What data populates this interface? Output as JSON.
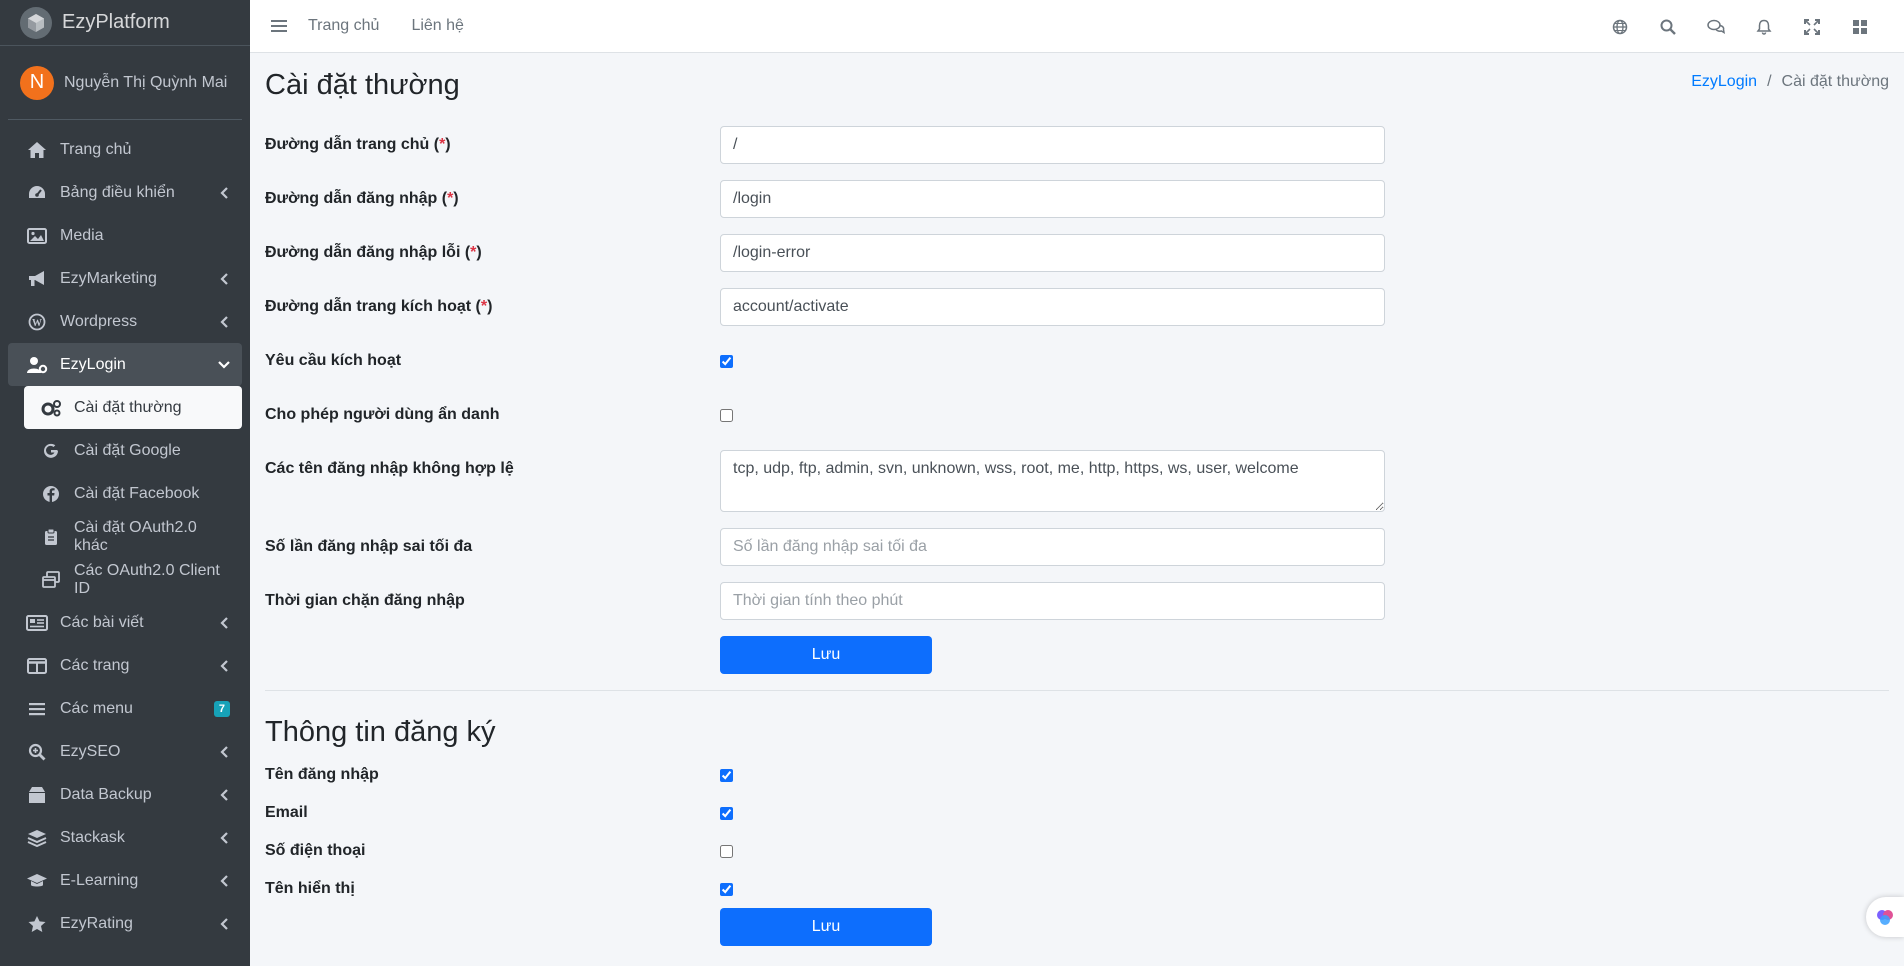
{
  "brand": {
    "name": "EzyPlatform"
  },
  "user": {
    "initial": "N",
    "name": "Nguyễn Thị Quỳnh Mai"
  },
  "sidebar": {
    "items": [
      {
        "label": "Trang chủ",
        "icon": "home-icon"
      },
      {
        "label": "Bảng điều khiển",
        "icon": "dashboard-icon"
      },
      {
        "label": "Media",
        "icon": "image-icon"
      },
      {
        "label": "EzyMarketing",
        "icon": "megaphone-icon"
      },
      {
        "label": "Wordpress",
        "icon": "wordpress-icon"
      },
      {
        "label": "EzyLogin",
        "icon": "user-cog-icon"
      },
      {
        "label": "Các bài viết",
        "icon": "newspaper-icon"
      },
      {
        "label": "Các trang",
        "icon": "columns-icon"
      },
      {
        "label": "Các menu",
        "icon": "bars-icon",
        "badge": "7"
      },
      {
        "label": "EzySEO",
        "icon": "search-plus-icon"
      },
      {
        "label": "Data Backup",
        "icon": "box-icon"
      },
      {
        "label": "Stackask",
        "icon": "layers-icon"
      },
      {
        "label": "E-Learning",
        "icon": "graduation-cap-icon"
      },
      {
        "label": "EzyRating",
        "icon": "star-icon"
      }
    ],
    "sub": [
      {
        "label": "Cài đặt thường",
        "icon": "gears-icon"
      },
      {
        "label": "Cài đặt Google",
        "icon": "google-icon"
      },
      {
        "label": "Cài đặt Facebook",
        "icon": "facebook-icon"
      },
      {
        "label": "Cài đặt OAuth2.0 khác",
        "icon": "clipboard-icon"
      },
      {
        "label": "Các OAuth2.0 Client ID",
        "icon": "window-restore-icon"
      }
    ]
  },
  "topbar": {
    "home": "Trang chủ",
    "contact": "Liên hệ"
  },
  "page": {
    "title": "Cài đặt thường",
    "breadcrumb": {
      "parent": "EzyLogin",
      "current": "Cài đặt thường"
    }
  },
  "form": {
    "home_path": {
      "label": "Đường dẫn trang chủ (",
      "req": "*",
      "end": ")",
      "value": "/"
    },
    "login_path": {
      "label": "Đường dẫn đăng nhập (",
      "req": "*",
      "end": ")",
      "value": "/login"
    },
    "login_error_path": {
      "label": "Đường dẫn đăng nhập lỗi (",
      "req": "*",
      "end": ")",
      "value": "/login-error"
    },
    "activate_path": {
      "label": "Đường dẫn trang kích hoạt (",
      "req": "*",
      "end": ")",
      "value": "account/activate"
    },
    "require_activation": {
      "label": "Yêu cầu kích hoạt",
      "checked": true
    },
    "allow_anonymous": {
      "label": "Cho phép người dùng ẩn danh",
      "checked": false
    },
    "invalid_usernames": {
      "label": "Các tên đăng nhập không hợp lệ",
      "value": "tcp, udp, ftp, admin, svn, unknown, wss, root, me, http, https, ws, user, welcome"
    },
    "max_failed": {
      "label": "Số lần đăng nhập sai tối đa",
      "placeholder": "Số lần đăng nhập sai tối đa"
    },
    "block_time": {
      "label": "Thời gian chặn đăng nhập",
      "placeholder": "Thời gian tính theo phút"
    },
    "save": "Lưu"
  },
  "register": {
    "title": "Thông tin đăng ký",
    "username": {
      "label": "Tên đăng nhập",
      "checked": true
    },
    "email": {
      "label": "Email",
      "checked": true
    },
    "phone": {
      "label": "Số điện thoại",
      "checked": false
    },
    "display_name": {
      "label": "Tên hiển thị",
      "checked": true
    },
    "save": "Lưu"
  }
}
